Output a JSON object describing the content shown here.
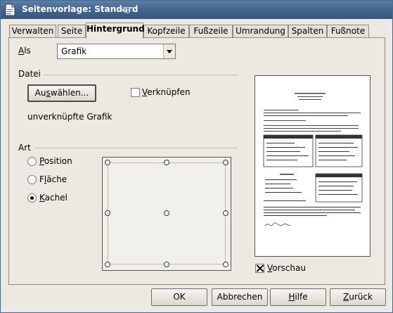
{
  "window": {
    "title": "Seitenvorlage: Standard"
  },
  "tabs": [
    {
      "label": "Verwalten",
      "active": false
    },
    {
      "label": "Seite",
      "active": false
    },
    {
      "label": "Hintergrund",
      "active": true
    },
    {
      "label": "Kopfzeile",
      "active": false
    },
    {
      "label": "Fußzeile",
      "active": false
    },
    {
      "label": "Umrandung",
      "active": false
    },
    {
      "label": "Spalten",
      "active": false
    },
    {
      "label": "Fußnote",
      "active": false
    }
  ],
  "as": {
    "label": "Als",
    "value": "Grafik"
  },
  "file": {
    "section_label": "Datei",
    "browse_button": "Auswählen...",
    "link_checkbox": {
      "label": "Verknüpfen",
      "checked": false
    },
    "status": "unverknüpfte Grafik"
  },
  "type": {
    "section_label": "Art",
    "options": [
      {
        "label": "Position",
        "selected": false
      },
      {
        "label": "Fläche",
        "selected": false
      },
      {
        "label": "Kachel",
        "selected": true
      }
    ]
  },
  "preview": {
    "checkbox_label": "Vorschau",
    "checked": true
  },
  "buttons": {
    "ok": "OK",
    "cancel": "Abbrechen",
    "help": "Hilfe",
    "back": "Zurück"
  }
}
